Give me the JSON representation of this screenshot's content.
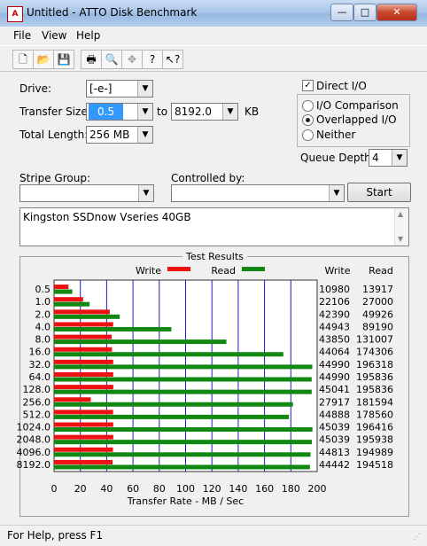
{
  "window": {
    "title": "Untitled - ATTO Disk Benchmark",
    "icon": "atto-icon",
    "buttons": [
      "—",
      "□",
      "✕"
    ]
  },
  "menu": [
    "File",
    "View",
    "Help"
  ],
  "toolbar": [
    "new-icon",
    "open-icon",
    "save-icon",
    "print-icon",
    "print-preview-icon",
    "move-icon",
    "help-icon",
    "context-help-icon"
  ],
  "form": {
    "drive_label": "Drive:",
    "drive_value": "[-e-]",
    "transfer_label": "Transfer Size:",
    "transfer_from": "0.5",
    "transfer_to_label": "to",
    "transfer_to": "8192.0",
    "transfer_unit": "KB",
    "length_label": "Total Length:",
    "length_value": "256 MB",
    "stripe_label": "Stripe Group:",
    "controlled_label": "Controlled by:",
    "start_label": "Start",
    "description": "Kingston  SSDnow Vseries 40GB"
  },
  "options": {
    "direct_io": "Direct I/O",
    "direct_io_checked": true,
    "radios": [
      {
        "label": "I/O Comparison",
        "checked": false
      },
      {
        "label": "Overlapped I/O",
        "checked": true
      },
      {
        "label": "Neither",
        "checked": false
      }
    ],
    "queue_label": "Queue Depth:",
    "queue_value": "4"
  },
  "results": {
    "title": "Test Results",
    "write_header": "Write",
    "read_header": "Read",
    "legend_write": "Write",
    "legend_read": "Read"
  },
  "colors": {
    "write": "#ee1111",
    "read": "#118811",
    "grid": "#1a1acc"
  },
  "chart_data": {
    "type": "bar",
    "orientation": "horizontal",
    "categories": [
      "0.5",
      "1.0",
      "2.0",
      "4.0",
      "8.0",
      "16.0",
      "32.0",
      "64.0",
      "128.0",
      "256.0",
      "512.0",
      "1024.0",
      "2048.0",
      "4096.0",
      "8192.0"
    ],
    "series": [
      {
        "name": "Write",
        "values": [
          10980,
          22106,
          42390,
          44943,
          43850,
          44064,
          44990,
          44990,
          45041,
          27917,
          44888,
          45039,
          45039,
          44813,
          44442
        ]
      },
      {
        "name": "Read",
        "values": [
          13917,
          27000,
          49926,
          89190,
          131007,
          174306,
          196318,
          195836,
          195836,
          181594,
          178560,
          196416,
          195938,
          194989,
          194518
        ]
      }
    ],
    "xlabel": "Transfer Rate - MB / Sec",
    "xticks": [
      "0",
      "20",
      "40",
      "60",
      "80",
      "100",
      "120",
      "140",
      "160",
      "180",
      "200"
    ],
    "xlim": [
      0,
      200
    ],
    "grid": true,
    "legend": "top"
  },
  "status": "For Help, press F1"
}
